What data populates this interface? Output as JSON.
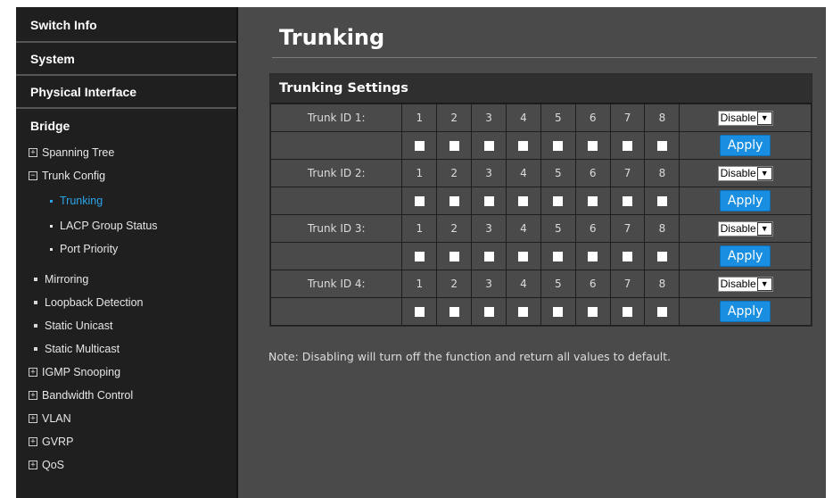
{
  "sidebar": {
    "sections": [
      {
        "label": "Switch Info"
      },
      {
        "label": "System"
      },
      {
        "label": "Physical Interface"
      },
      {
        "label": "Bridge"
      }
    ],
    "items": [
      {
        "label": "Spanning Tree",
        "marker": "+"
      },
      {
        "label": "Trunk Config",
        "marker": "−"
      },
      {
        "label": "Trunking",
        "active": true
      },
      {
        "label": "LACP Group Status"
      },
      {
        "label": "Port Priority"
      },
      {
        "label": "Mirroring"
      },
      {
        "label": "Loopback Detection"
      },
      {
        "label": "Static Unicast"
      },
      {
        "label": "Static Multicast"
      },
      {
        "label": "IGMP Snooping",
        "marker": "+"
      },
      {
        "label": "Bandwidth Control",
        "marker": "+"
      },
      {
        "label": "VLAN",
        "marker": "+"
      },
      {
        "label": "GVRP",
        "marker": "+"
      },
      {
        "label": "QoS",
        "marker": "+"
      }
    ]
  },
  "main": {
    "title": "Trunking",
    "settings_title": "Trunking Settings",
    "ports": [
      "1",
      "2",
      "3",
      "4",
      "5",
      "6",
      "7",
      "8"
    ],
    "trunks": [
      {
        "label": "Trunk ID 1:",
        "select_value": "Disable",
        "apply_label": "Apply"
      },
      {
        "label": "Trunk ID 2:",
        "select_value": "Disable",
        "apply_label": "Apply"
      },
      {
        "label": "Trunk ID 3:",
        "select_value": "Disable",
        "apply_label": "Apply"
      },
      {
        "label": "Trunk ID 4:",
        "select_value": "Disable",
        "apply_label": "Apply"
      }
    ],
    "note": "Note: Disabling will turn off the function and return all values to default."
  },
  "colors": {
    "accent": "#2aa5e8",
    "apply_button": "#1a8ee0",
    "sidebar_bg": "#1f1f1f",
    "main_bg": "#4a4a4a"
  },
  "icons": {
    "expand": "plus-box-icon",
    "collapse": "minus-box-icon",
    "select_arrow": "chevron-down-icon"
  }
}
